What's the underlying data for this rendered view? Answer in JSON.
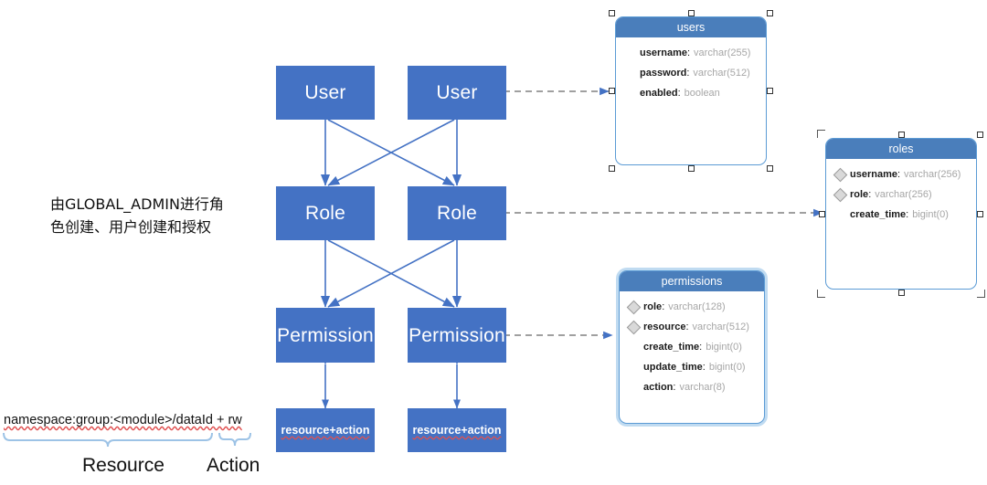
{
  "diagram": {
    "title": "RBAC permission model diagram",
    "colors": {
      "box_fill": "#4472C4",
      "table_header": "#4A7EBB",
      "table_border": "#5B9BD5",
      "arrow": "#4472C4",
      "dashed_connector": "#808080",
      "spellcheck_underline": "#e05050",
      "brace": "#9DC3E6"
    }
  },
  "flow": {
    "columns": [
      {
        "user_label": "User",
        "role_label": "Role",
        "permission_label": "Permission",
        "resource_action_label": "resource+action"
      },
      {
        "user_label": "User",
        "role_label": "Role",
        "permission_label": "Permission",
        "resource_action_label": "resource+action"
      }
    ]
  },
  "note": {
    "line1": "由GLOBAL_ADMIN进行角",
    "line2": "色创建、用户创建和授权"
  },
  "legend": {
    "expression": "namespace:group:<module>/dataId + rw",
    "resource_label": "Resource",
    "action_label": "Action"
  },
  "tables": [
    {
      "name": "users",
      "selected": true,
      "fields": [
        {
          "key": false,
          "name": "username",
          "type": "varchar(255)"
        },
        {
          "key": false,
          "name": "password",
          "type": "varchar(512)"
        },
        {
          "key": false,
          "name": "enabled",
          "type": "boolean"
        }
      ]
    },
    {
      "name": "roles",
      "selected": true,
      "fields": [
        {
          "key": true,
          "name": "username",
          "type": "varchar(256)"
        },
        {
          "key": true,
          "name": "role",
          "type": "varchar(256)"
        },
        {
          "key": false,
          "name": "create_time",
          "type": "bigint(0)"
        }
      ]
    },
    {
      "name": "permissions",
      "selected": false,
      "fields": [
        {
          "key": true,
          "name": "role",
          "type": "varchar(128)"
        },
        {
          "key": true,
          "name": "resource",
          "type": "varchar(512)"
        },
        {
          "key": false,
          "name": "create_time",
          "type": "bigint(0)"
        },
        {
          "key": false,
          "name": "update_time",
          "type": "bigint(0)"
        },
        {
          "key": false,
          "name": "action",
          "type": "varchar(8)"
        }
      ]
    }
  ]
}
